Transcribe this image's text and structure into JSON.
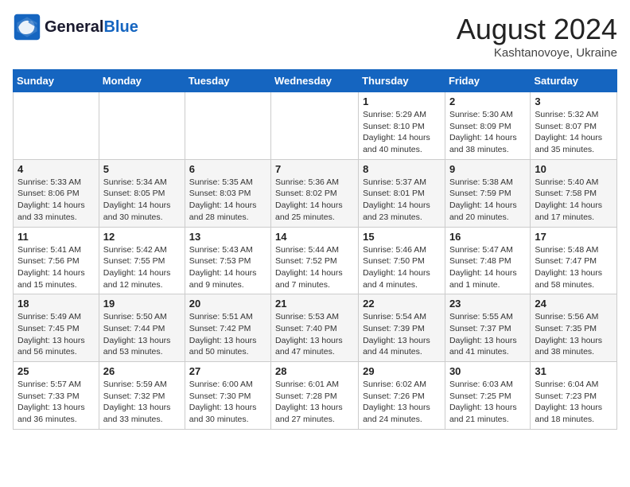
{
  "logo": {
    "line1": "General",
    "line2": "Blue"
  },
  "title": "August 2024",
  "location": "Kashtanovoye, Ukraine",
  "days_header": [
    "Sunday",
    "Monday",
    "Tuesday",
    "Wednesday",
    "Thursday",
    "Friday",
    "Saturday"
  ],
  "weeks": [
    [
      {
        "day": "",
        "info": ""
      },
      {
        "day": "",
        "info": ""
      },
      {
        "day": "",
        "info": ""
      },
      {
        "day": "",
        "info": ""
      },
      {
        "day": "1",
        "info": "Sunrise: 5:29 AM\nSunset: 8:10 PM\nDaylight: 14 hours\nand 40 minutes."
      },
      {
        "day": "2",
        "info": "Sunrise: 5:30 AM\nSunset: 8:09 PM\nDaylight: 14 hours\nand 38 minutes."
      },
      {
        "day": "3",
        "info": "Sunrise: 5:32 AM\nSunset: 8:07 PM\nDaylight: 14 hours\nand 35 minutes."
      }
    ],
    [
      {
        "day": "4",
        "info": "Sunrise: 5:33 AM\nSunset: 8:06 PM\nDaylight: 14 hours\nand 33 minutes."
      },
      {
        "day": "5",
        "info": "Sunrise: 5:34 AM\nSunset: 8:05 PM\nDaylight: 14 hours\nand 30 minutes."
      },
      {
        "day": "6",
        "info": "Sunrise: 5:35 AM\nSunset: 8:03 PM\nDaylight: 14 hours\nand 28 minutes."
      },
      {
        "day": "7",
        "info": "Sunrise: 5:36 AM\nSunset: 8:02 PM\nDaylight: 14 hours\nand 25 minutes."
      },
      {
        "day": "8",
        "info": "Sunrise: 5:37 AM\nSunset: 8:01 PM\nDaylight: 14 hours\nand 23 minutes."
      },
      {
        "day": "9",
        "info": "Sunrise: 5:38 AM\nSunset: 7:59 PM\nDaylight: 14 hours\nand 20 minutes."
      },
      {
        "day": "10",
        "info": "Sunrise: 5:40 AM\nSunset: 7:58 PM\nDaylight: 14 hours\nand 17 minutes."
      }
    ],
    [
      {
        "day": "11",
        "info": "Sunrise: 5:41 AM\nSunset: 7:56 PM\nDaylight: 14 hours\nand 15 minutes."
      },
      {
        "day": "12",
        "info": "Sunrise: 5:42 AM\nSunset: 7:55 PM\nDaylight: 14 hours\nand 12 minutes."
      },
      {
        "day": "13",
        "info": "Sunrise: 5:43 AM\nSunset: 7:53 PM\nDaylight: 14 hours\nand 9 minutes."
      },
      {
        "day": "14",
        "info": "Sunrise: 5:44 AM\nSunset: 7:52 PM\nDaylight: 14 hours\nand 7 minutes."
      },
      {
        "day": "15",
        "info": "Sunrise: 5:46 AM\nSunset: 7:50 PM\nDaylight: 14 hours\nand 4 minutes."
      },
      {
        "day": "16",
        "info": "Sunrise: 5:47 AM\nSunset: 7:48 PM\nDaylight: 14 hours\nand 1 minute."
      },
      {
        "day": "17",
        "info": "Sunrise: 5:48 AM\nSunset: 7:47 PM\nDaylight: 13 hours\nand 58 minutes."
      }
    ],
    [
      {
        "day": "18",
        "info": "Sunrise: 5:49 AM\nSunset: 7:45 PM\nDaylight: 13 hours\nand 56 minutes."
      },
      {
        "day": "19",
        "info": "Sunrise: 5:50 AM\nSunset: 7:44 PM\nDaylight: 13 hours\nand 53 minutes."
      },
      {
        "day": "20",
        "info": "Sunrise: 5:51 AM\nSunset: 7:42 PM\nDaylight: 13 hours\nand 50 minutes."
      },
      {
        "day": "21",
        "info": "Sunrise: 5:53 AM\nSunset: 7:40 PM\nDaylight: 13 hours\nand 47 minutes."
      },
      {
        "day": "22",
        "info": "Sunrise: 5:54 AM\nSunset: 7:39 PM\nDaylight: 13 hours\nand 44 minutes."
      },
      {
        "day": "23",
        "info": "Sunrise: 5:55 AM\nSunset: 7:37 PM\nDaylight: 13 hours\nand 41 minutes."
      },
      {
        "day": "24",
        "info": "Sunrise: 5:56 AM\nSunset: 7:35 PM\nDaylight: 13 hours\nand 38 minutes."
      }
    ],
    [
      {
        "day": "25",
        "info": "Sunrise: 5:57 AM\nSunset: 7:33 PM\nDaylight: 13 hours\nand 36 minutes."
      },
      {
        "day": "26",
        "info": "Sunrise: 5:59 AM\nSunset: 7:32 PM\nDaylight: 13 hours\nand 33 minutes."
      },
      {
        "day": "27",
        "info": "Sunrise: 6:00 AM\nSunset: 7:30 PM\nDaylight: 13 hours\nand 30 minutes."
      },
      {
        "day": "28",
        "info": "Sunrise: 6:01 AM\nSunset: 7:28 PM\nDaylight: 13 hours\nand 27 minutes."
      },
      {
        "day": "29",
        "info": "Sunrise: 6:02 AM\nSunset: 7:26 PM\nDaylight: 13 hours\nand 24 minutes."
      },
      {
        "day": "30",
        "info": "Sunrise: 6:03 AM\nSunset: 7:25 PM\nDaylight: 13 hours\nand 21 minutes."
      },
      {
        "day": "31",
        "info": "Sunrise: 6:04 AM\nSunset: 7:23 PM\nDaylight: 13 hours\nand 18 minutes."
      }
    ]
  ]
}
